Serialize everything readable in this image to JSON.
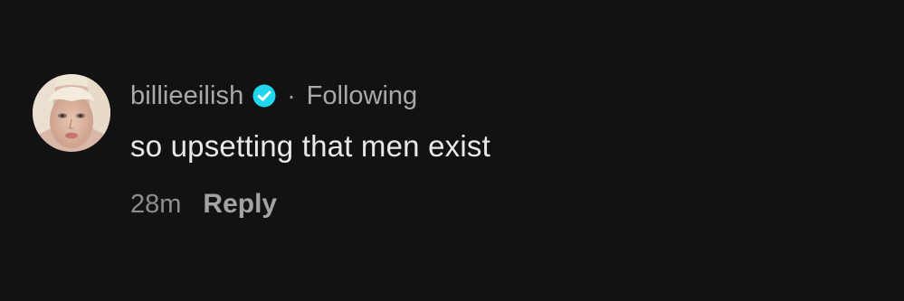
{
  "comment": {
    "avatar_icon": "profile-photo-avatar",
    "username": "billieeilish",
    "verified_icon": "verified-check-icon",
    "separator": "·",
    "follow_status": "Following",
    "text": "so upsetting that men exist",
    "timestamp": "28m",
    "reply_label": "Reply"
  },
  "colors": {
    "background": "#121213",
    "username": "#a9a9ab",
    "comment_text": "#e9e9ea",
    "verified_badge": "#20d5ec",
    "timestamp": "#8e8e90"
  }
}
